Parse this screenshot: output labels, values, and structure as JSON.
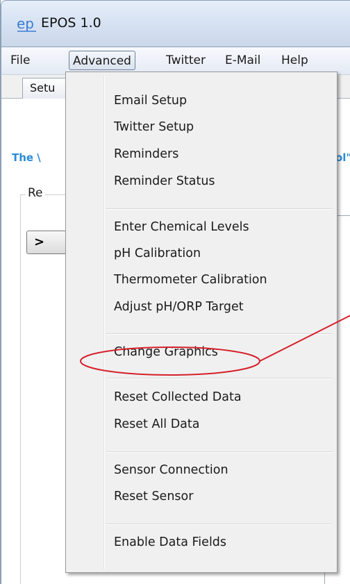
{
  "window": {
    "title": "EPOS 1.0",
    "logo_text": "ep"
  },
  "menubar": {
    "items": [
      "File",
      "Advanced",
      "Twitter",
      "E-Mail",
      "Help"
    ],
    "active": "Advanced"
  },
  "tabs": {
    "first_tab_label": "Setu"
  },
  "content": {
    "blue_title_left": "The \\",
    "blue_title_right": "ol\"",
    "group_label": "Re",
    "nav_button_label": ">"
  },
  "dropdown": {
    "items": [
      "Email Setup",
      "Twitter Setup",
      "Reminders",
      "Reminder Status",
      "Enter Chemical Levels",
      "pH Calibration",
      "Thermometer Calibration",
      "Adjust pH/ORP Target",
      "Change Graphics",
      "Reset Collected Data",
      "Reset All Data",
      "Sensor Connection",
      "Reset Sensor",
      "Enable Data Fields"
    ],
    "highlighted": "Change Graphics"
  },
  "colors": {
    "accent_blue": "#2a8bd8",
    "annotation_red": "#d6202a",
    "logo_blue": "#3a7bd5"
  }
}
